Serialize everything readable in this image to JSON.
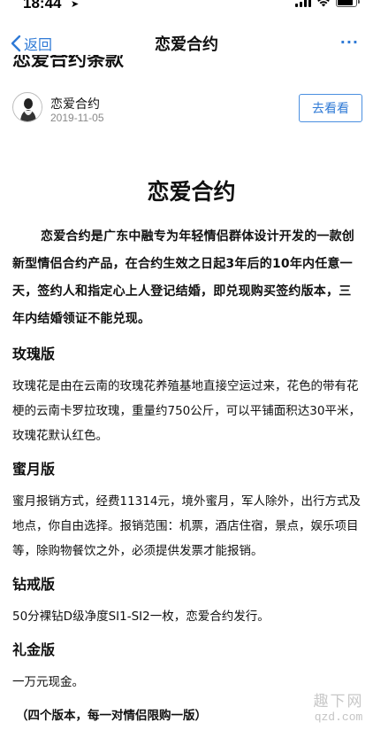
{
  "status": {
    "time": "18:44",
    "location_icon": "location-arrow-icon",
    "icons": [
      "signal-icon",
      "wifi-icon",
      "battery-icon"
    ]
  },
  "nav": {
    "back_label": "返回",
    "title": "恋爱合约",
    "more_label": "···"
  },
  "article": {
    "title_partial": "恋爱合约条款",
    "author": "恋爱合约",
    "date": "2019-11-05",
    "visit_button": "去看看"
  },
  "doc": {
    "title": "恋爱合约",
    "intro": "恋爱合约是广东中融专为年轻情侣群体设计开发的一款创新型情侣合约产品，在合约生效之日起3年后的10年内任意一天，签约人和指定心上人登记结婚，即兑现购买签约版本，三年内结婚领证不能兑现。",
    "sections": [
      {
        "heading": "玫瑰版",
        "text": "玫瑰花是由在云南的玫瑰花养殖基地直接空运过来，花色的带有花梗的云南卡罗拉玫瑰，重量约750公斤，可以平铺面积达30平米，玫瑰花默认红色。"
      },
      {
        "heading": "蜜月版",
        "text": "蜜月报销方式，经费11314元，境外蜜月，军人除外，出行方式及地点，你自由选择。报销范围：机票，酒店住宿，景点，娱乐项目等，除购物餐饮之外，必须提供发票才能报销。"
      },
      {
        "heading": "钻戒版",
        "text": "50分裸钻D级净度SI1-SI2一枚，恋爱合约发行。"
      },
      {
        "heading": "礼金版",
        "text": "一万元现金。"
      }
    ],
    "note": "（四个版本，每一对情侣限购一版）"
  },
  "watermark": {
    "top": "趣下网",
    "bottom": "qzd.com"
  },
  "colors": {
    "accent": "#2f7ad6",
    "text": "#111111",
    "muted": "#888888"
  }
}
